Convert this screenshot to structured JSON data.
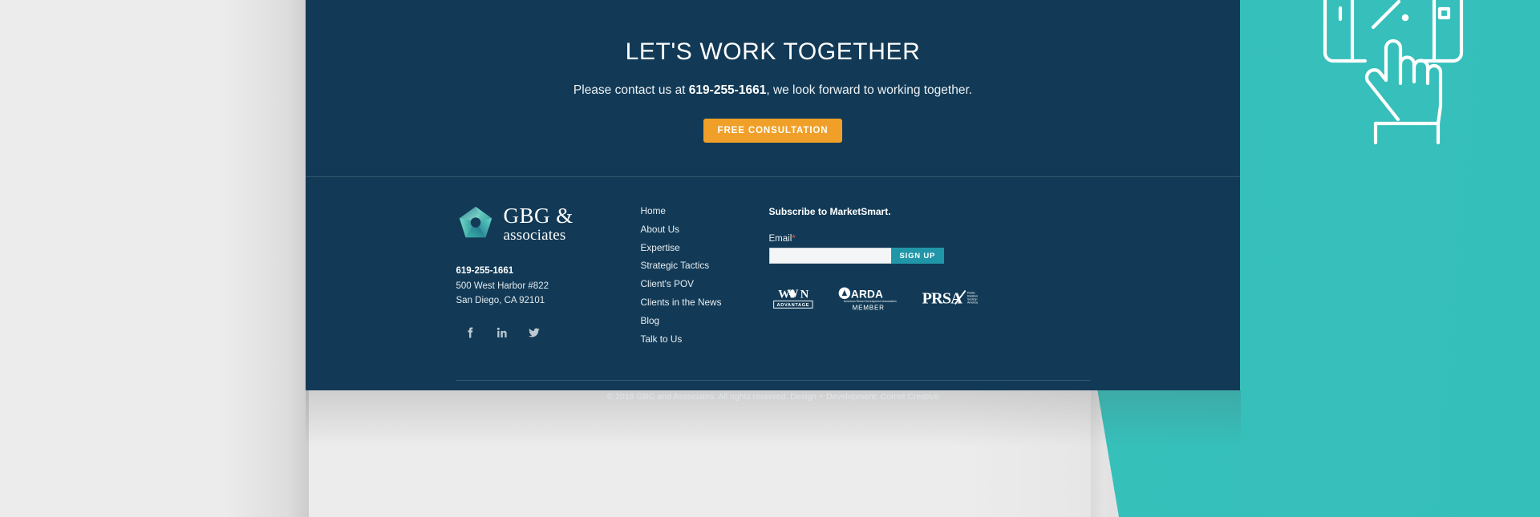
{
  "colors": {
    "panel_dark": "#123A56",
    "teal": "#3CC1BB",
    "cta_button": "#F0A028",
    "signup_button": "#2196A8",
    "required_star": "#E8553B",
    "page_background": "#ECECEC"
  },
  "cta": {
    "heading": "LET'S WORK TOGETHER",
    "body_prefix": "Please contact us at ",
    "phone": "619-255-1661",
    "body_suffix": ", we look forward to working together.",
    "button_label": "FREE CONSULTATION"
  },
  "footer": {
    "logo": {
      "line1": "GBG &",
      "line2": "associates",
      "mark_name": "gbg-aperture-logo"
    },
    "contact": {
      "phone": "619-255-1661",
      "address_line1": "500 West Harbor #822",
      "address_line2": "San Diego, CA 92101"
    },
    "socials": [
      {
        "name": "facebook-icon",
        "label": "Facebook"
      },
      {
        "name": "linkedin-icon",
        "label": "LinkedIn"
      },
      {
        "name": "twitter-icon",
        "label": "Twitter"
      }
    ],
    "nav": [
      {
        "label": "Home"
      },
      {
        "label": "About Us"
      },
      {
        "label": "Expertise"
      },
      {
        "label": "Strategic Tactics"
      },
      {
        "label": "Client's POV"
      },
      {
        "label": "Clients in the News"
      },
      {
        "label": "Blog"
      },
      {
        "label": "Talk to Us"
      }
    ],
    "subscribe": {
      "title": "Subscribe to MarketSmart.",
      "email_label": "Email",
      "required_mark": "*",
      "email_value": "",
      "email_placeholder": "",
      "button_label": "SIGN UP"
    },
    "partners": [
      {
        "name": "win-advantage-logo",
        "primary": "WIN",
        "secondary": "ADVANTAGE"
      },
      {
        "name": "arda-member-logo",
        "primary": "ARDA",
        "subtitle": "American Resort Development Association",
        "secondary": "MEMBER"
      },
      {
        "name": "prsa-logo",
        "primary": "PRSA",
        "subtitle": "Public Relations Society of America"
      }
    ],
    "copyright": "© 2018 GBG and Associates. All rights reserved. Design + Development: Comet Creative"
  },
  "decoration": {
    "illustration_name": "hand-tapping-tablet-percent-illustration"
  }
}
